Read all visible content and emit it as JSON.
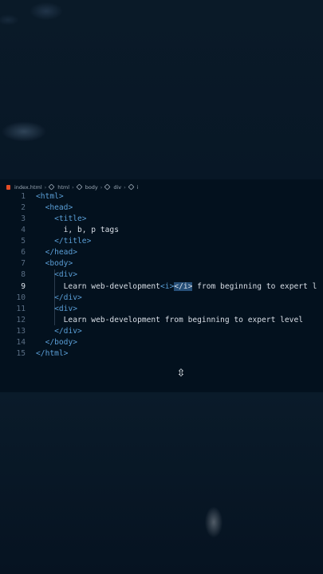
{
  "breadcrumb": {
    "file": "index.html",
    "items": [
      "html",
      "body",
      "div",
      "i"
    ]
  },
  "code_lines": [
    {
      "num": "1",
      "indent": "",
      "parts": [
        [
          "tag",
          "<"
        ],
        [
          "tname",
          "html"
        ],
        [
          "tag",
          ">"
        ]
      ]
    },
    {
      "num": "2",
      "indent": "  ",
      "parts": [
        [
          "tag",
          "<"
        ],
        [
          "tname",
          "head"
        ],
        [
          "tag",
          ">"
        ]
      ]
    },
    {
      "num": "3",
      "indent": "    ",
      "parts": [
        [
          "tag",
          "<"
        ],
        [
          "tname",
          "title"
        ],
        [
          "tag",
          ">"
        ]
      ]
    },
    {
      "num": "4",
      "indent": "      ",
      "parts": [
        [
          "txt",
          "i, b, p tags"
        ]
      ]
    },
    {
      "num": "5",
      "indent": "    ",
      "parts": [
        [
          "tag",
          "</"
        ],
        [
          "tname",
          "title"
        ],
        [
          "tag",
          ">"
        ]
      ]
    },
    {
      "num": "6",
      "indent": "  ",
      "parts": [
        [
          "tag",
          "</"
        ],
        [
          "tname",
          "head"
        ],
        [
          "tag",
          ">"
        ]
      ]
    },
    {
      "num": "7",
      "indent": "  ",
      "parts": [
        [
          "tag",
          "<"
        ],
        [
          "tname",
          "body"
        ],
        [
          "tag",
          ">"
        ]
      ]
    },
    {
      "num": "8",
      "indent": "    ",
      "parts": [
        [
          "tag",
          "<"
        ],
        [
          "tname",
          "div"
        ],
        [
          "tag",
          ">"
        ]
      ]
    },
    {
      "num": "9",
      "indent": "      ",
      "parts": [
        [
          "txt",
          "Learn web-development"
        ],
        [
          "tag",
          "<"
        ],
        [
          "tname",
          "i"
        ],
        [
          "tag",
          ">"
        ],
        [
          "sel",
          "</i>"
        ],
        [
          "txt",
          " from beginning to expert l"
        ]
      ]
    },
    {
      "num": "10",
      "indent": "    ",
      "parts": [
        [
          "tag",
          "</"
        ],
        [
          "tname",
          "div"
        ],
        [
          "tag",
          ">"
        ]
      ]
    },
    {
      "num": "11",
      "indent": "    ",
      "parts": [
        [
          "tag",
          "<"
        ],
        [
          "tname",
          "div"
        ],
        [
          "tag",
          ">"
        ]
      ]
    },
    {
      "num": "12",
      "indent": "      ",
      "parts": [
        [
          "txt",
          "Learn web-development from beginning to expert level"
        ]
      ]
    },
    {
      "num": "13",
      "indent": "    ",
      "parts": [
        [
          "tag",
          "</"
        ],
        [
          "tname",
          "div"
        ],
        [
          "tag",
          ">"
        ]
      ]
    },
    {
      "num": "14",
      "indent": "  ",
      "parts": [
        [
          "tag",
          "</"
        ],
        [
          "tname",
          "body"
        ],
        [
          "tag",
          ">"
        ]
      ]
    },
    {
      "num": "15",
      "indent": "",
      "parts": [
        [
          "tag",
          "</"
        ],
        [
          "tname",
          "html"
        ],
        [
          "tag",
          ">"
        ]
      ]
    }
  ],
  "active_line": "9",
  "cursor_icon": "resize-vertical-icon",
  "colors": {
    "background": "#071523",
    "editor_bg": "#03111e",
    "tag": "#5a9ed6",
    "text": "#d8dee6",
    "line_number": "#5a6e84",
    "selection": "#264f78"
  }
}
